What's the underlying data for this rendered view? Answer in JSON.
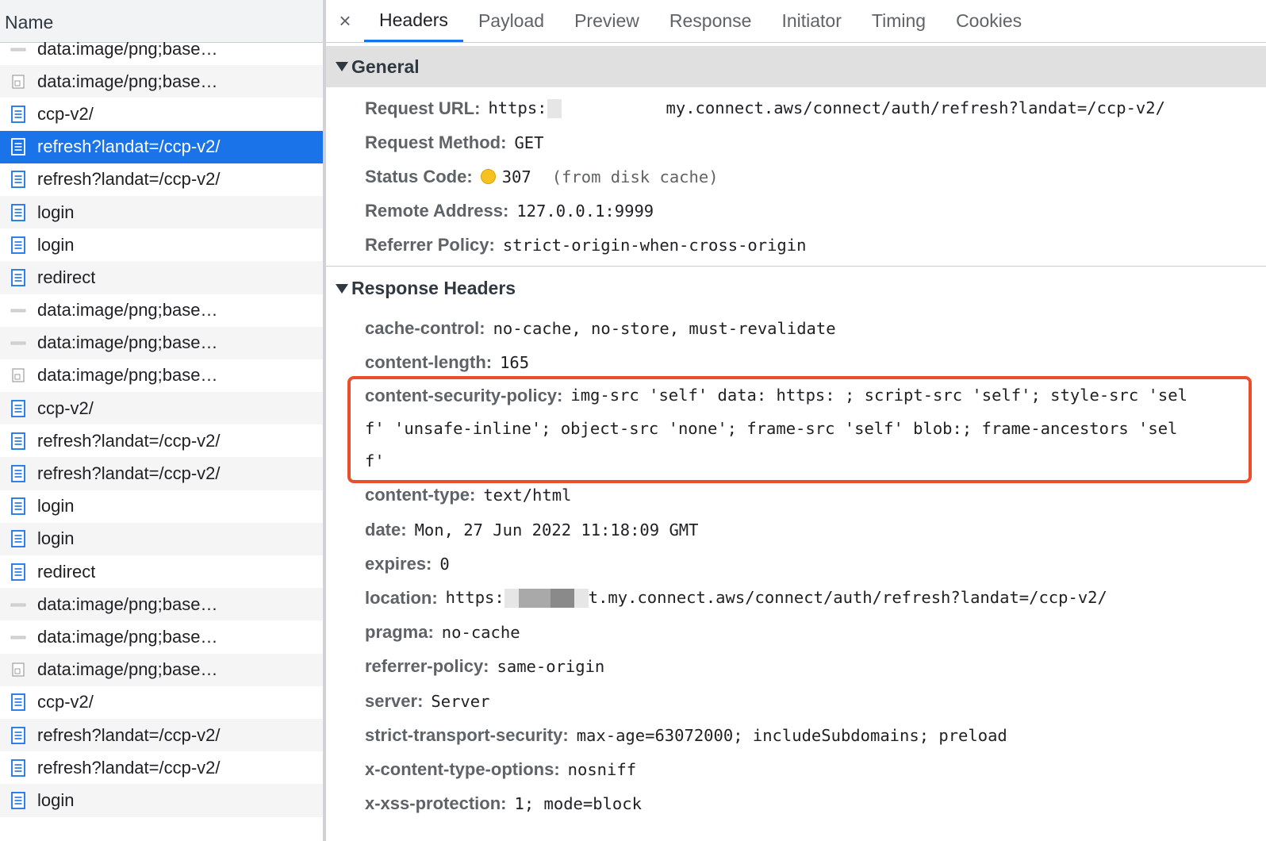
{
  "request_list": {
    "header": "Name",
    "rows": [
      {
        "label": "data:image/png;base…",
        "icon": "image-line-icon"
      },
      {
        "label": "data:image/png;base…",
        "icon": "image-file-icon"
      },
      {
        "label": "ccp-v2/",
        "icon": "document-icon"
      },
      {
        "label": "refresh?landat=/ccp-v2/",
        "icon": "document-icon",
        "selected": true
      },
      {
        "label": "refresh?landat=/ccp-v2/",
        "icon": "document-icon"
      },
      {
        "label": "login",
        "icon": "document-icon"
      },
      {
        "label": "login",
        "icon": "document-icon"
      },
      {
        "label": "redirect",
        "icon": "document-icon"
      },
      {
        "label": "data:image/png;base…",
        "icon": "image-line-icon"
      },
      {
        "label": "data:image/png;base…",
        "icon": "image-line-icon"
      },
      {
        "label": "data:image/png;base…",
        "icon": "image-file-icon"
      },
      {
        "label": "ccp-v2/",
        "icon": "document-icon"
      },
      {
        "label": "refresh?landat=/ccp-v2/",
        "icon": "document-icon"
      },
      {
        "label": "refresh?landat=/ccp-v2/",
        "icon": "document-icon"
      },
      {
        "label": "login",
        "icon": "document-icon"
      },
      {
        "label": "login",
        "icon": "document-icon"
      },
      {
        "label": "redirect",
        "icon": "document-icon"
      },
      {
        "label": "data:image/png;base…",
        "icon": "image-line-icon"
      },
      {
        "label": "data:image/png;base…",
        "icon": "image-line-icon"
      },
      {
        "label": "data:image/png;base…",
        "icon": "image-file-icon"
      },
      {
        "label": "ccp-v2/",
        "icon": "document-icon"
      },
      {
        "label": "refresh?landat=/ccp-v2/",
        "icon": "document-icon"
      },
      {
        "label": "refresh?landat=/ccp-v2/",
        "icon": "document-icon"
      },
      {
        "label": "login",
        "icon": "document-icon"
      }
    ]
  },
  "tabs": {
    "close": "×",
    "items": [
      "Headers",
      "Payload",
      "Preview",
      "Response",
      "Initiator",
      "Timing",
      "Cookies"
    ],
    "active": "Headers"
  },
  "general": {
    "title": "General",
    "request_url_key": "Request URL:",
    "request_url_prefix": "https:",
    "request_url_suffix": "my.connect.aws/connect/auth/refresh?landat=/ccp-v2/",
    "request_method_key": "Request Method:",
    "request_method": "GET",
    "status_code_key": "Status Code:",
    "status_code": "307",
    "status_note": "(from disk cache)",
    "remote_address_key": "Remote Address:",
    "remote_address": "127.0.0.1:9999",
    "referrer_policy_key": "Referrer Policy:",
    "referrer_policy": "strict-origin-when-cross-origin"
  },
  "response_headers": {
    "title": "Response Headers",
    "cache_control_key": "cache-control:",
    "cache_control": "no-cache, no-store, must-revalidate",
    "content_length_key": "content-length:",
    "content_length": "165",
    "csp_key": "content-security-policy:",
    "csp_line1": "img-src 'self' data: https: ; script-src 'self'; style-src 'sel",
    "csp_line2": "f' 'unsafe-inline'; object-src 'none'; frame-src 'self' blob:; frame-ancestors 'sel",
    "csp_line3": "f'",
    "content_type_key": "content-type:",
    "content_type": "text/html",
    "date_key": "date:",
    "date": "Mon, 27 Jun 2022 11:18:09 GMT",
    "expires_key": "expires:",
    "expires": "0",
    "location_key": "location:",
    "location_prefix": "https:",
    "location_suffix": "t.my.connect.aws/connect/auth/refresh?landat=/ccp-v2/",
    "pragma_key": "pragma:",
    "pragma": "no-cache",
    "referrer_policy_key": "referrer-policy:",
    "referrer_policy": "same-origin",
    "server_key": "server:",
    "server": "Server",
    "hsts_key": "strict-transport-security:",
    "hsts": "max-age=63072000; includeSubdomains; preload",
    "xcto_key": "x-content-type-options:",
    "xcto": "nosniff",
    "xxss_key": "x-xss-protection:",
    "xxss": "1; mode=block"
  },
  "colors": {
    "selected_row": "#1a73e8",
    "active_tab_underline": "#1a73e8",
    "highlight_box": "#e94f2d",
    "status_dot": "#f7c21f"
  }
}
